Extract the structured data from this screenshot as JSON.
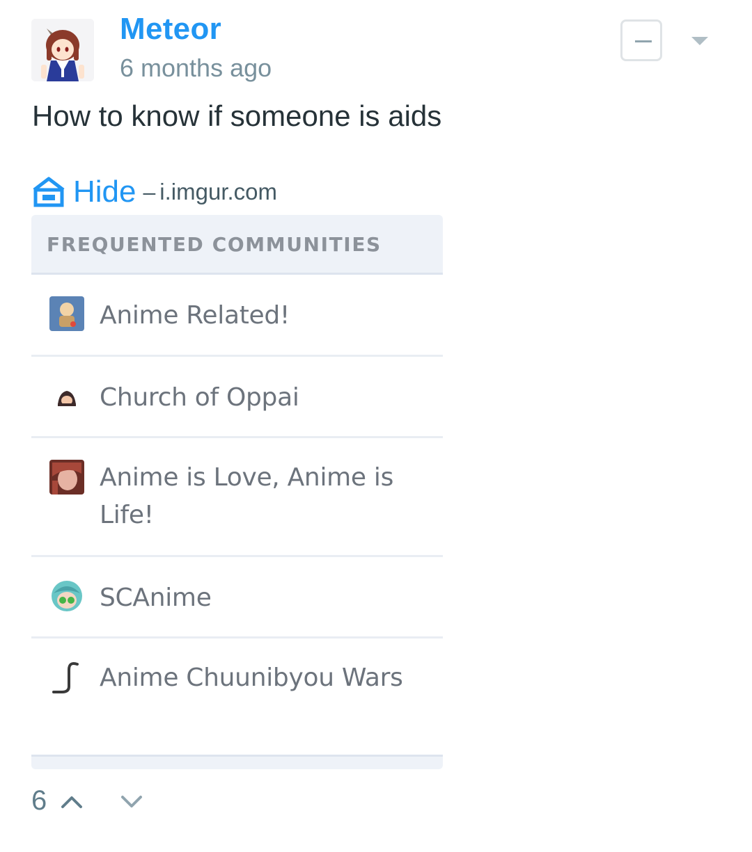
{
  "comment": {
    "author": "Meteor",
    "time_ago": "6 months ago",
    "text": "How to know if someone is aids"
  },
  "link": {
    "toggle_label": "Hide",
    "separator": "–",
    "domain": "i.imgur.com"
  },
  "embed": {
    "header": "FREQUENTED COMMUNITIES",
    "communities": [
      {
        "name": "Anime Related!",
        "icon": "anime-related-icon"
      },
      {
        "name": "Church of Oppai",
        "icon": "church-of-oppai-icon"
      },
      {
        "name": "Anime is Love, Anime is Life!",
        "icon": "anime-is-love-icon"
      },
      {
        "name": "SCAnime",
        "icon": "scanime-icon"
      },
      {
        "name": "Anime Chuunibyou Wars",
        "icon": "anime-chuunibyou-wars-icon"
      }
    ]
  },
  "votes": {
    "score": "6"
  },
  "colors": {
    "accent": "#2196f3",
    "muted": "#78909c",
    "text": "#263238"
  }
}
